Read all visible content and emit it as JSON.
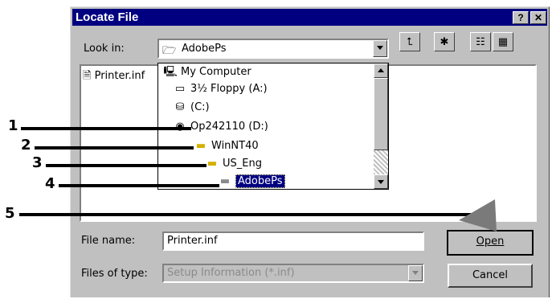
{
  "window": {
    "title": "Locate File",
    "help_label": "?",
    "close_label": "✕"
  },
  "look_in": {
    "label": "Look in:",
    "value": "AdobePs",
    "icon": "folder-open-icon"
  },
  "toolbar": {
    "up_icon": "up-folder-icon",
    "new_folder_icon": "new-folder-icon",
    "list_icon": "list-view-icon",
    "details_icon": "details-view-icon"
  },
  "file_list": {
    "items": [
      {
        "name": "Printer.inf",
        "icon": "inf-file-icon"
      }
    ]
  },
  "dropdown": {
    "items": [
      {
        "label": "My Computer",
        "icon": "computer-icon"
      },
      {
        "label": "3½ Floppy (A:)",
        "icon": "floppy-icon"
      },
      {
        "label": "(C:)",
        "icon": "drive-icon"
      },
      {
        "label": "Op242110 (D:)",
        "icon": "cd-drive-icon"
      },
      {
        "label": "WinNT40",
        "icon": "folder-icon"
      },
      {
        "label": "US_Eng",
        "icon": "folder-icon"
      },
      {
        "label": "AdobePs",
        "icon": "folder-open-icon",
        "selected": true
      }
    ]
  },
  "file_name": {
    "label": "File name:",
    "value": "Printer.inf"
  },
  "files_of_type": {
    "label": "Files of type:",
    "value": "Setup Information (*.inf)"
  },
  "buttons": {
    "open": "Open",
    "cancel": "Cancel"
  },
  "callouts": [
    "1",
    "2",
    "3",
    "4",
    "5"
  ],
  "colors": {
    "titlebar": "#000080",
    "selection": "#000080",
    "dialog": "#c0c0c0"
  }
}
